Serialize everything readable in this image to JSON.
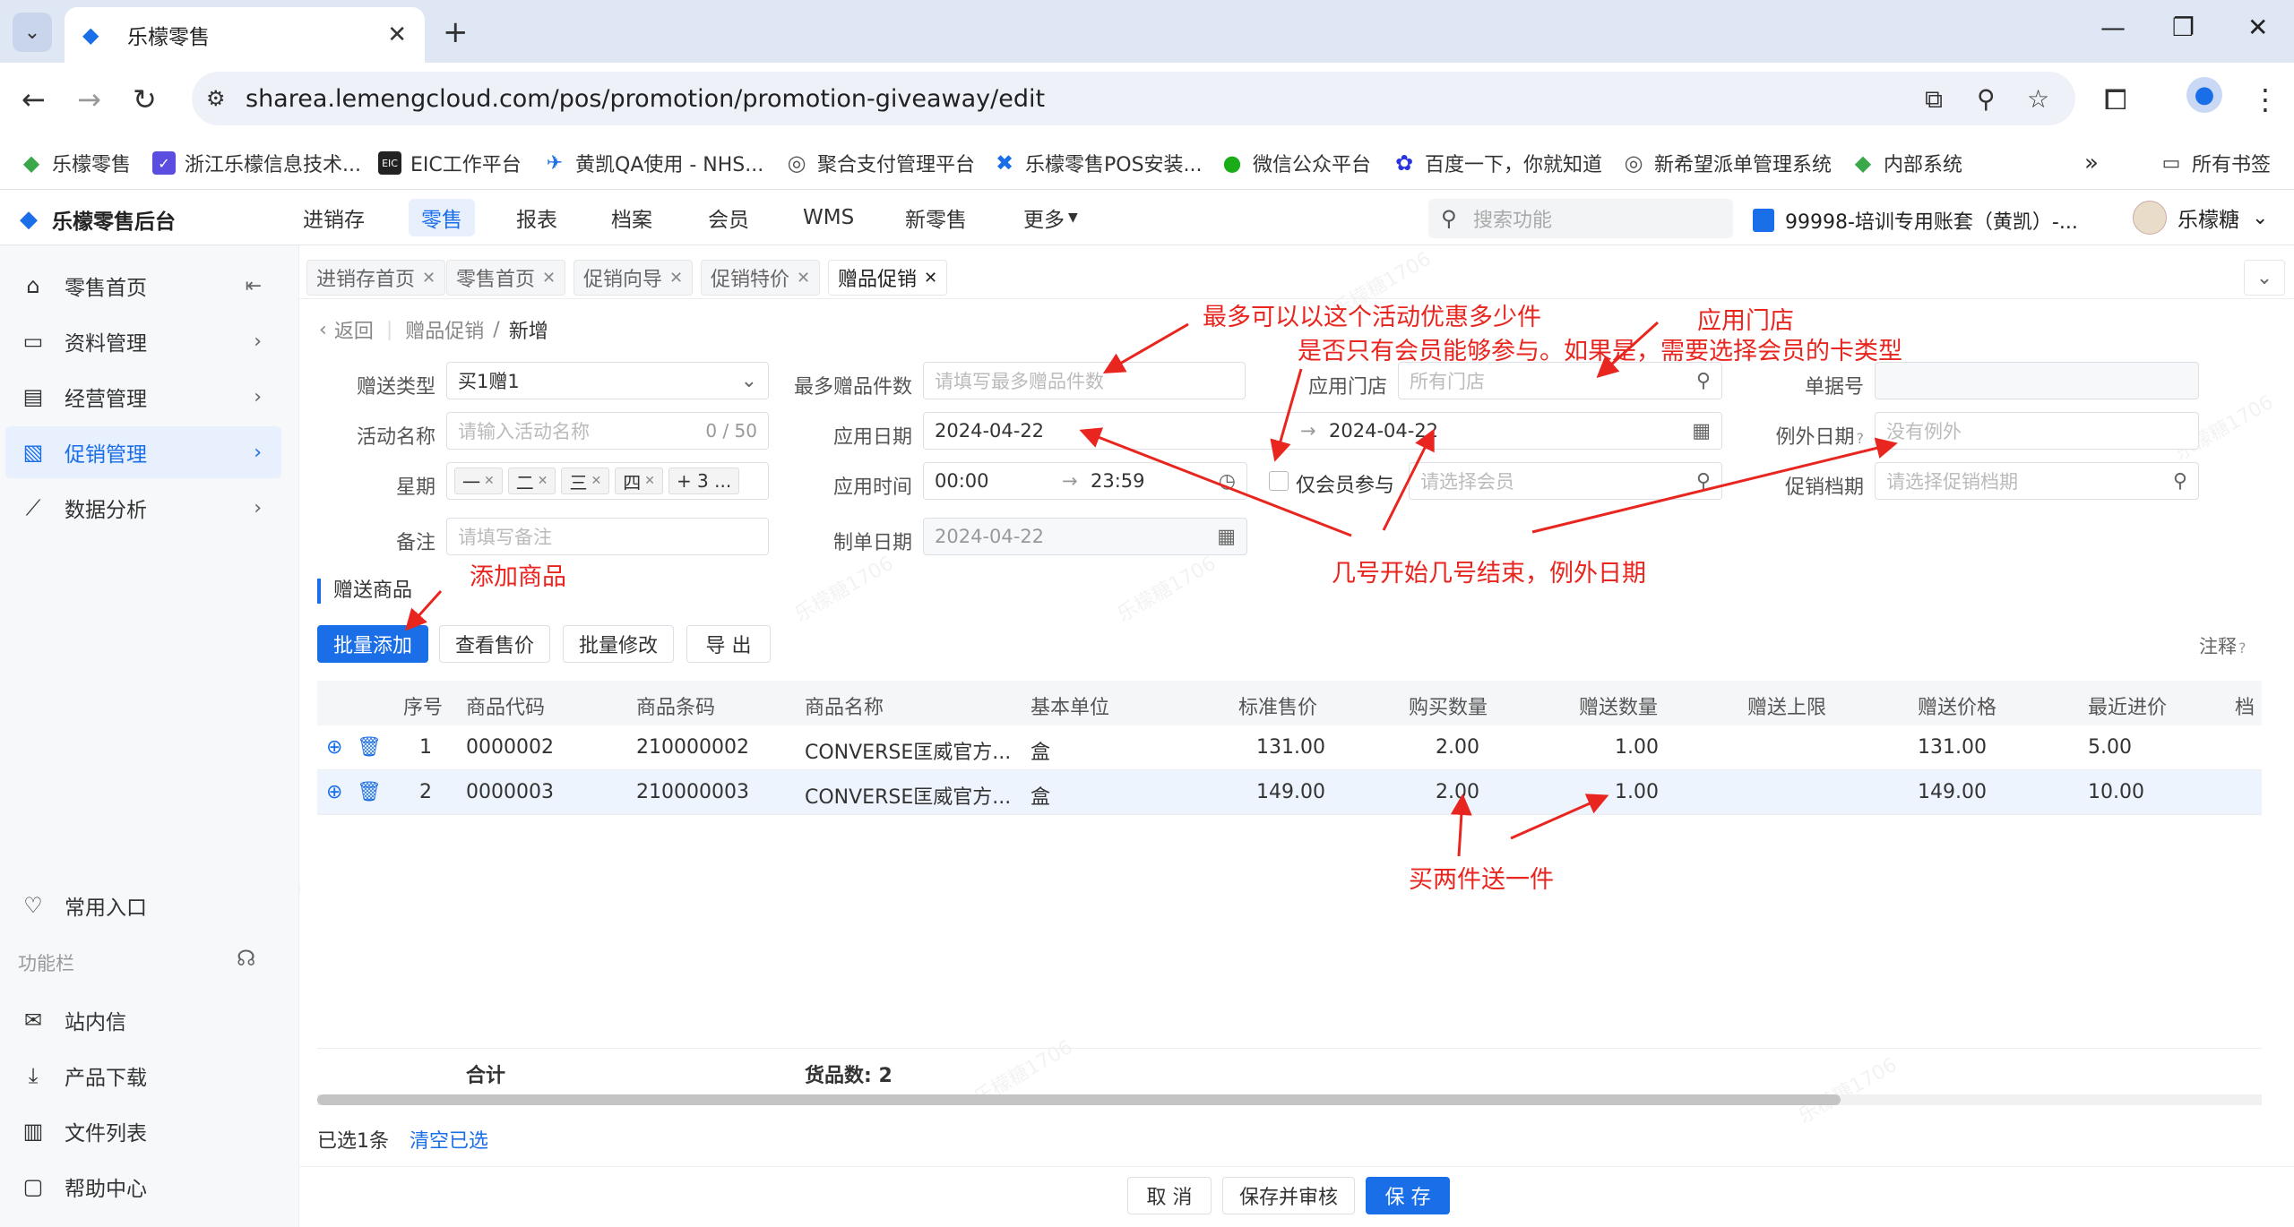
{
  "browser": {
    "tab_title": "乐檬零售",
    "url": "sharea.lemengcloud.com/pos/promotion/promotion-giveaway/edit",
    "bookmarks": [
      "乐檬零售",
      "浙江乐檬信息技术...",
      "EIC工作平台",
      "黄凯QA使用 - NHS...",
      "聚合支付管理平台",
      "乐檬零售POS安装...",
      "微信公众平台",
      "百度一下，你就知道",
      "新希望派单管理系统",
      "内部系统"
    ],
    "bookmarks_all": "所有书签"
  },
  "header": {
    "brand": "乐檬零售后台",
    "nav": [
      "进销存",
      "零售",
      "报表",
      "档案",
      "会员",
      "WMS",
      "新零售",
      "更多"
    ],
    "search_placeholder": "搜索功能",
    "account": "99998-培训专用账套（黄凯）-...",
    "user": "乐檬糖"
  },
  "sidebar": {
    "items": [
      {
        "label": "零售首页",
        "icon": "home-icon"
      },
      {
        "label": "资料管理",
        "icon": "folder-icon"
      },
      {
        "label": "经营管理",
        "icon": "chart-board-icon"
      },
      {
        "label": "促销管理",
        "icon": "promotion-icon"
      },
      {
        "label": "数据分析",
        "icon": "line-chart-icon"
      }
    ],
    "common_entry": "常用入口",
    "func_bar": "功能栏",
    "bottom_items": [
      "站内信",
      "产品下载",
      "文件列表",
      "帮助中心"
    ]
  },
  "page_tabs": [
    "进销存首页",
    "零售首页",
    "促销向导",
    "促销特价",
    "赠品促销"
  ],
  "breadcrumb": {
    "back": "返回",
    "parent": "赠品促销",
    "sep": "/",
    "current": "新增"
  },
  "form": {
    "gift_type_label": "赠送类型",
    "gift_type_value": "买1赠1",
    "max_gift_label": "最多赠品件数",
    "max_gift_placeholder": "请填写最多赠品件数",
    "store_label": "应用门店",
    "store_placeholder": "所有门店",
    "doc_no_label": "单据号",
    "activity_name_label": "活动名称",
    "activity_name_placeholder": "请输入活动名称",
    "activity_name_count": "0 / 50",
    "date_label": "应用日期",
    "date_start": "2024-04-22",
    "date_end": "2024-04-22",
    "date_arrow": "→",
    "exception_date_label": "例外日期",
    "exception_date_placeholder": "没有例外",
    "week_label": "星期",
    "week_tags": [
      "一",
      "二",
      "三",
      "四"
    ],
    "week_more": "+ 3 ...",
    "time_label": "应用时间",
    "time_start": "00:00",
    "time_end": "23:59",
    "time_arrow": "→",
    "member_only_label": "仅会员参与",
    "member_placeholder": "请选择会员",
    "promo_file_label": "促销档期",
    "promo_file_placeholder": "请选择促销档期",
    "remark_label": "备注",
    "remark_placeholder": "请填写备注",
    "create_date_label": "制单日期",
    "create_date_value": "2024-04-22"
  },
  "goods_section": {
    "title": "赠送商品",
    "buttons": [
      "批量添加",
      "查看售价",
      "批量修改",
      "导 出"
    ],
    "note": "注释"
  },
  "table": {
    "columns": [
      "序号",
      "商品代码",
      "商品条码",
      "商品名称",
      "基本单位",
      "标准售价",
      "购买数量",
      "赠送数量",
      "赠送上限",
      "赠送价格",
      "最近进价",
      "档"
    ],
    "rows": [
      {
        "no": "1",
        "code": "0000002",
        "barcode": "210000002",
        "name": "CONVERSE匡威官方...",
        "unit": "盒",
        "std_price": "131.00",
        "buy_qty": "2.00",
        "gift_qty": "1.00",
        "limit": "",
        "gift_price": "131.00",
        "recent_price": "5.00"
      },
      {
        "no": "2",
        "code": "0000003",
        "barcode": "210000003",
        "name": "CONVERSE匡威官方...",
        "unit": "盒",
        "std_price": "149.00",
        "buy_qty": "2.00",
        "gift_qty": "1.00",
        "limit": "",
        "gift_price": "149.00",
        "recent_price": "10.00"
      }
    ],
    "footer_total": "合计",
    "footer_count": "货品数: 2"
  },
  "selection": {
    "info": "已选1条",
    "clear": "清空已选"
  },
  "footer_buttons": [
    "取 消",
    "保存并审核",
    "保 存"
  ],
  "annotations": {
    "max_gift": "最多可以以这个活动优惠多少件",
    "store": "应用门店",
    "member": "是否只有会员能够参与。如果是，需要选择会员的卡类型",
    "add_goods": "添加商品",
    "dates": "几号开始几号结束，例外日期",
    "buy_two": "买两件送一件"
  },
  "watermark": "乐檬糖1706",
  "colors": {
    "accent": "#1a6ee8",
    "annotation": "#e8261f"
  }
}
